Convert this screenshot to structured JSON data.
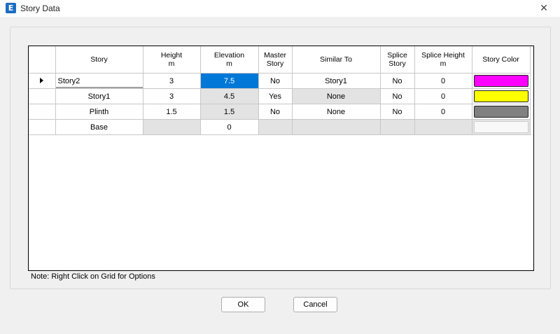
{
  "window": {
    "title": "Story Data",
    "app_icon_letter": "E",
    "close_glyph": "✕"
  },
  "grid": {
    "headers": [
      {
        "line1": "Story",
        "line2": ""
      },
      {
        "line1": "Height",
        "line2": "m"
      },
      {
        "line1": "Elevation",
        "line2": "m"
      },
      {
        "line1": "Master",
        "line2": "Story"
      },
      {
        "line1": "Similar To",
        "line2": ""
      },
      {
        "line1": "Splice",
        "line2": "Story"
      },
      {
        "line1": "Splice Height",
        "line2": "m"
      },
      {
        "line1": "Story Color",
        "line2": ""
      }
    ],
    "rows": [
      {
        "story": "Story2",
        "height": "3",
        "elevation": "7.5",
        "master": "No",
        "similar_to": "Story1",
        "splice": "No",
        "splice_height": "0",
        "color": "#ff00ff",
        "current": true
      },
      {
        "story": "Story1",
        "height": "3",
        "elevation": "4.5",
        "master": "Yes",
        "similar_to": "None",
        "splice": "No",
        "splice_height": "0",
        "color": "#ffff00",
        "current": false
      },
      {
        "story": "Plinth",
        "height": "1.5",
        "elevation": "1.5",
        "master": "No",
        "similar_to": "None",
        "splice": "No",
        "splice_height": "0",
        "color": "#808080",
        "current": false
      },
      {
        "story": "Base",
        "height": "",
        "elevation": "0",
        "master": "",
        "similar_to": "",
        "splice": "",
        "splice_height": "",
        "color": "",
        "current": false
      }
    ]
  },
  "note": "Note:  Right Click on Grid for Options",
  "buttons": {
    "ok": "OK",
    "cancel": "Cancel"
  },
  "colors": {
    "selection": "#0078d7",
    "readonly_cell": "#e3e3e3",
    "app_icon": "#1b6ec2"
  }
}
